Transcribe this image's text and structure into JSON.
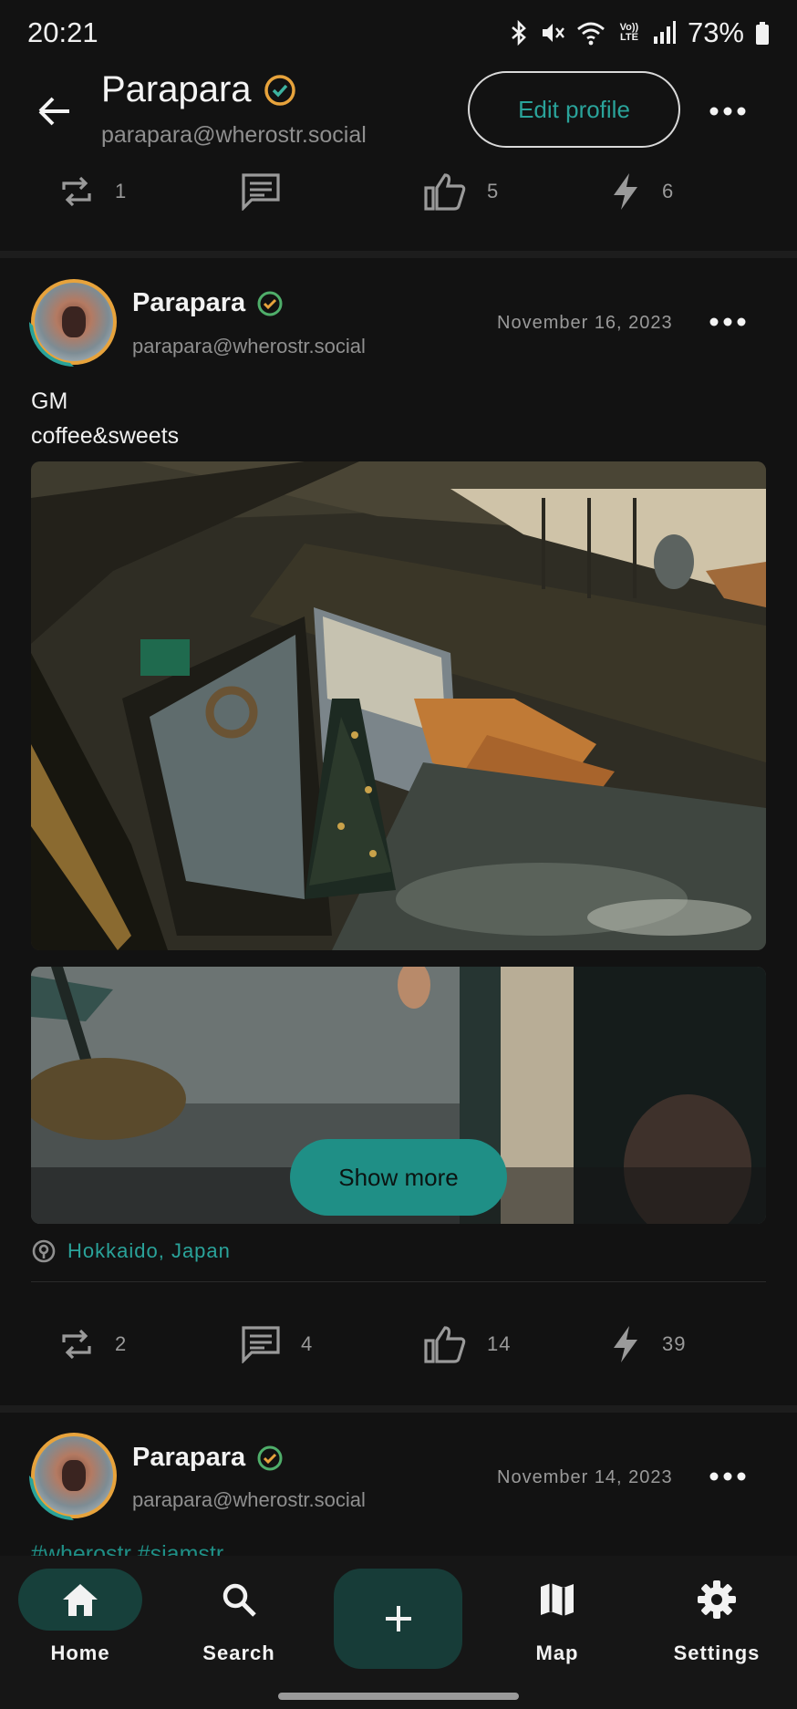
{
  "status_bar": {
    "time": "20:21",
    "network_label": "Vo)) LTE",
    "battery": "73%"
  },
  "header": {
    "title": "Parapara",
    "handle": "parapara@wherostr.social",
    "edit_profile_label": "Edit profile",
    "accent_color": "#2aa39a"
  },
  "previous_post": {
    "reposts": "1",
    "likes": "5",
    "zaps": "6"
  },
  "posts": [
    {
      "author": "Parapara",
      "handle": "parapara@wherostr.social",
      "date": "November 16, 2023",
      "text_line1": "GM",
      "text_line2": "coffee&sweets",
      "show_more_label": "Show more",
      "location": "Hokkaido, Japan",
      "reposts": "2",
      "comments": "4",
      "likes": "14",
      "zaps": "39"
    },
    {
      "author": "Parapara",
      "handle": "parapara@wherostr.social",
      "date": "November 14, 2023",
      "hashtags": "#wherostr #siamstr"
    }
  ],
  "bottom_nav": {
    "items": [
      {
        "label": "Home",
        "icon": "home-icon",
        "active": true
      },
      {
        "label": "Search",
        "icon": "search-icon"
      },
      {
        "label": "Map",
        "icon": "map-icon"
      },
      {
        "label": "Settings",
        "icon": "settings-icon"
      }
    ],
    "fab_icon": "plus-icon"
  }
}
